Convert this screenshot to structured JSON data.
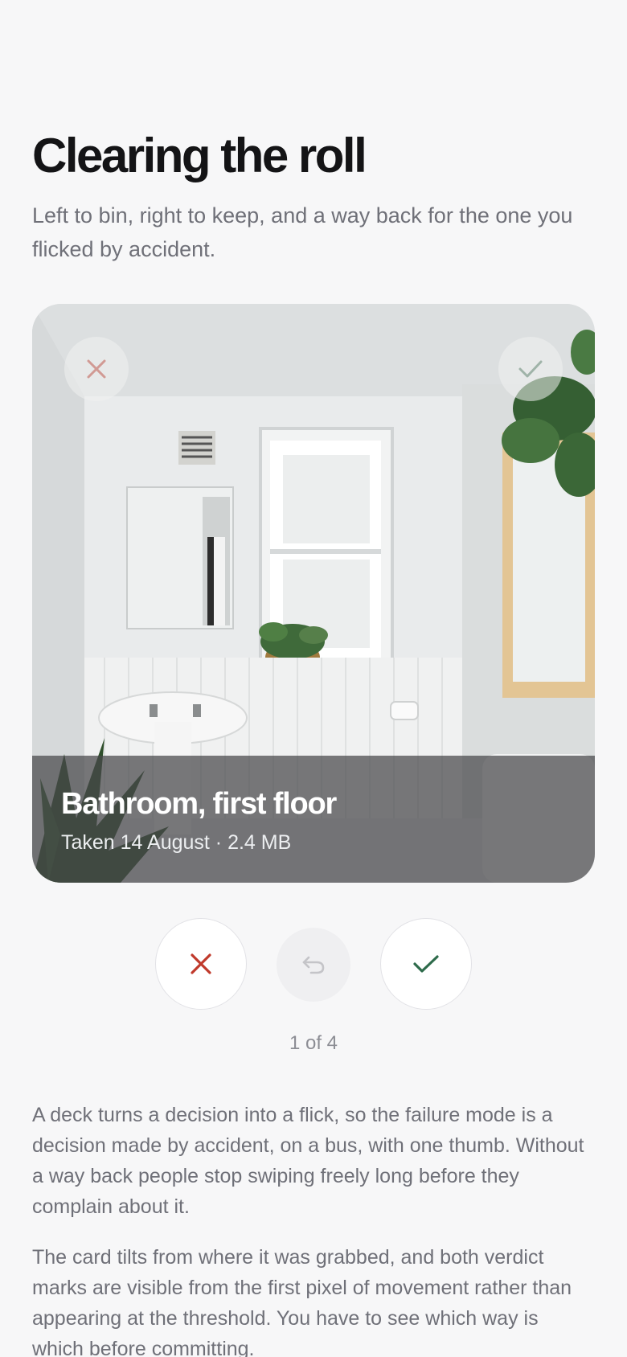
{
  "header": {
    "title": "Clearing the roll",
    "subtitle": "Left to bin, right to keep, and a way back for the one you flicked by accident."
  },
  "card": {
    "photo_name": "Bathroom, first floor",
    "meta": "Taken 14 August · 2.4 MB",
    "bin_mark_icon": "close-icon",
    "keep_mark_icon": "check-icon"
  },
  "actions": {
    "reject_icon": "close-icon",
    "undo_icon": "undo-icon",
    "accept_icon": "check-icon",
    "reject_color": "#c0392b",
    "accept_color": "#2e6b4b"
  },
  "progress": {
    "label": "1 of 4",
    "current": 1,
    "total": 4
  },
  "body": {
    "paragraph_1": "A deck turns a decision into a flick, so the failure mode is a decision made by accident, on a bus, with one thumb. Without a way back people stop swiping freely long before they complain about it.",
    "paragraph_2": "The card tilts from where it was grabbed, and both verdict marks are visible from the first pixel of movement rather than appearing at the threshold. You have to see which way is which before committing."
  }
}
